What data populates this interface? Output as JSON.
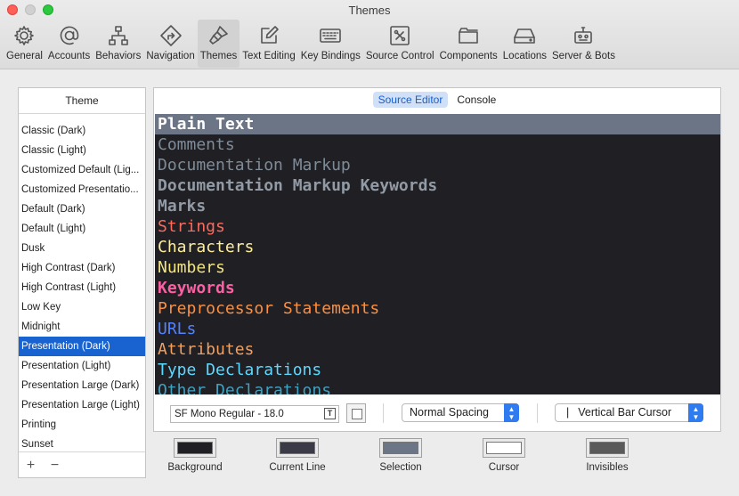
{
  "window": {
    "title": "Themes"
  },
  "toolbar": {
    "items": [
      {
        "label": "General",
        "icon": "gear-icon"
      },
      {
        "label": "Accounts",
        "icon": "at-sign-icon"
      },
      {
        "label": "Behaviors",
        "icon": "hierarchy-icon"
      },
      {
        "label": "Navigation",
        "icon": "navigation-arrow-icon"
      },
      {
        "label": "Themes",
        "icon": "paintbrush-icon",
        "active": true
      },
      {
        "label": "Text Editing",
        "icon": "edit-pencil-icon"
      },
      {
        "label": "Key Bindings",
        "icon": "keyboard-icon"
      },
      {
        "label": "Source Control",
        "icon": "source-control-icon"
      },
      {
        "label": "Components",
        "icon": "components-box-icon"
      },
      {
        "label": "Locations",
        "icon": "drive-icon"
      },
      {
        "label": "Server & Bots",
        "icon": "robot-icon"
      }
    ]
  },
  "themes": {
    "header": "Theme",
    "items": [
      "Classic (Dark)",
      "Classic (Light)",
      "Customized Default (Lig...",
      "Customized Presentatio...",
      "Default (Dark)",
      "Default (Light)",
      "Dusk",
      "High Contrast (Dark)",
      "High Contrast (Light)",
      "Low Key",
      "Midnight",
      "Presentation (Dark)",
      "Presentation (Light)",
      "Presentation Large (Dark)",
      "Presentation Large (Light)",
      "Printing",
      "Sunset"
    ],
    "selected": "Presentation (Dark)",
    "add_label": "+",
    "remove_label": "−"
  },
  "editor": {
    "tabs": [
      {
        "label": "Source Editor",
        "active": true
      },
      {
        "label": "Console",
        "active": false
      }
    ],
    "syntax_items": [
      {
        "text": "Plain Text",
        "color": "#ffffff",
        "bold": true,
        "current": true
      },
      {
        "text": "Comments",
        "color": "#7f8c98",
        "bold": false
      },
      {
        "text": "Documentation Markup",
        "color": "#7f8c98",
        "bold": false
      },
      {
        "text": "Documentation Markup Keywords",
        "color": "#929ba5",
        "bold": true
      },
      {
        "text": "Marks",
        "color": "#929ba5",
        "bold": true
      },
      {
        "text": "Strings",
        "color": "#fc6a5d",
        "bold": false
      },
      {
        "text": "Characters",
        "color": "#fdee9e",
        "bold": false
      },
      {
        "text": "Numbers",
        "color": "#f3e47f",
        "bold": false
      },
      {
        "text": "Keywords",
        "color": "#fc5fa3",
        "bold": true
      },
      {
        "text": "Preprocessor Statements",
        "color": "#fd8f3f",
        "bold": false
      },
      {
        "text": "URLs",
        "color": "#5482ff",
        "bold": false
      },
      {
        "text": "Attributes",
        "color": "#f0a060",
        "bold": false
      },
      {
        "text": "Type Declarations",
        "color": "#5dd8ff",
        "bold": false
      },
      {
        "text": "Other Declarations",
        "color": "#41a1c0",
        "bold": false
      }
    ],
    "font_value": "SF Mono Regular - 18.0",
    "font_picker_icon": "text-font-icon",
    "spacing_value": "Normal Spacing",
    "cursor_value": "Vertical Bar Cursor",
    "cursor_prefix": "|"
  },
  "color_wells": [
    {
      "label": "Background",
      "color": "#1f1f24"
    },
    {
      "label": "Current Line",
      "color": "#3a3b46"
    },
    {
      "label": "Selection",
      "color": "#6b7585"
    },
    {
      "label": "Cursor",
      "color": "#ffffff"
    },
    {
      "label": "Invisibles",
      "color": "#5a5a5a"
    }
  ]
}
